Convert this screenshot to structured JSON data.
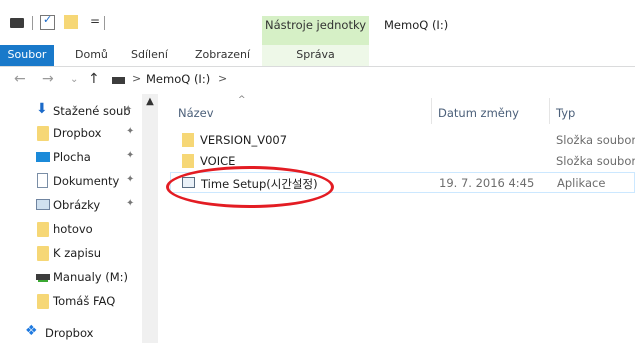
{
  "window": {
    "title": "MemoQ (I:)",
    "context_tab_group": "Nástroje jednotky",
    "qat_separator": "="
  },
  "ribbon": {
    "tabs": [
      {
        "label": "Soubor"
      },
      {
        "label": "Domů"
      },
      {
        "label": "Sdílení"
      },
      {
        "label": "Zobrazení"
      },
      {
        "label": "Správa"
      }
    ]
  },
  "address": {
    "path_label": "MemoQ (I:)",
    "separator": ">"
  },
  "navpane": {
    "items": [
      {
        "label": "Stažené soub",
        "icon": "download-arrow-icon",
        "pinned": true
      },
      {
        "label": "Dropbox",
        "icon": "folder-icon",
        "pinned": true
      },
      {
        "label": "Plocha",
        "icon": "desktop-icon",
        "pinned": true
      },
      {
        "label": "Dokumenty",
        "icon": "document-icon",
        "pinned": true
      },
      {
        "label": "Obrázky",
        "icon": "pictures-icon",
        "pinned": true
      },
      {
        "label": "hotovo",
        "icon": "folder-icon",
        "pinned": false
      },
      {
        "label": "K zapisu",
        "icon": "folder-icon",
        "pinned": false
      },
      {
        "label": "Manualy (M:)",
        "icon": "network-drive-icon",
        "pinned": false
      },
      {
        "label": "Tomáš FAQ",
        "icon": "folder-icon",
        "pinned": false
      },
      {
        "label": "Dropbox",
        "icon": "dropbox-icon",
        "pinned": false
      }
    ]
  },
  "columns": {
    "name": "Název",
    "date": "Datum změny",
    "type": "Typ"
  },
  "files": [
    {
      "name": "VERSION_V007",
      "date": "",
      "type": "Složka souborů",
      "icon": "folder-icon"
    },
    {
      "name": "VOICE",
      "date": "",
      "type": "Složka souborů",
      "icon": "folder-icon"
    },
    {
      "name": "Time Setup(시간설정)",
      "date": "19. 7. 2016 4:45",
      "type": "Aplikace",
      "icon": "application-icon"
    }
  ],
  "colors": {
    "accent": "#1979ca",
    "context_tab": "#d6f0c6",
    "annotation": "#e31c23"
  }
}
